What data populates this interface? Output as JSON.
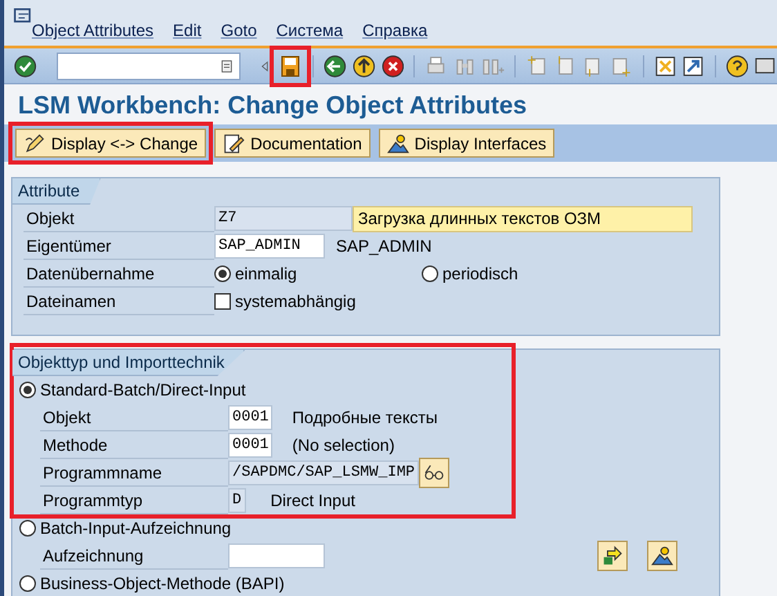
{
  "menu": [
    "Object Attributes",
    "Edit",
    "Goto",
    "Система",
    "Справка"
  ],
  "toolbar": {
    "save_highlighted": true
  },
  "title": "LSM Workbench: Change Object Attributes",
  "buttons": [
    {
      "label": "Display <-> Change",
      "kind": "pencil",
      "highlighted": true
    },
    {
      "label": "Documentation",
      "kind": "doc",
      "highlighted": false
    },
    {
      "label": "Display Interfaces",
      "kind": "mountain",
      "highlighted": false
    }
  ],
  "attributes": {
    "title": "Attribute",
    "rows": [
      {
        "kind": "field",
        "label": "Objekt",
        "value": "Z7",
        "readonly": true,
        "description": "Загрузка длинных текстов ОЗМ"
      },
      {
        "kind": "field",
        "label": "Eigentümer",
        "value": "SAP_ADMIN",
        "readonly": false,
        "text": "SAP_ADMIN"
      },
      {
        "kind": "radios",
        "label": "Datenübernahme",
        "options": [
          {
            "label": "einmalig",
            "selected": true
          },
          {
            "label": "periodisch",
            "selected": false
          }
        ]
      },
      {
        "kind": "checkbox",
        "label": "Dateinamen",
        "option": "systemabhängig",
        "checked": false
      }
    ]
  },
  "import": {
    "title": "Objekttyp und Importtechnik",
    "highlighted": true,
    "options": [
      {
        "label": "Standard-Batch/Direct-Input",
        "selected": true,
        "fields": [
          {
            "label": "Objekt",
            "value": "0001",
            "text": "Подробные тексты"
          },
          {
            "label": "Methode",
            "value": "0001",
            "text": "(No selection)"
          },
          {
            "label": "Programmname",
            "value": "/SAPDMC/SAP_LSMW_IMP",
            "help": true
          },
          {
            "label": "Programmtyp",
            "value": "D",
            "text": "Direct Input"
          }
        ]
      },
      {
        "label": "Batch-Input-Aufzeichnung",
        "selected": false,
        "fields": [
          {
            "label": "Aufzeichnung",
            "actions": true
          }
        ]
      },
      {
        "label": "Business-Object-Methode (BAPI)",
        "selected": false
      }
    ]
  }
}
